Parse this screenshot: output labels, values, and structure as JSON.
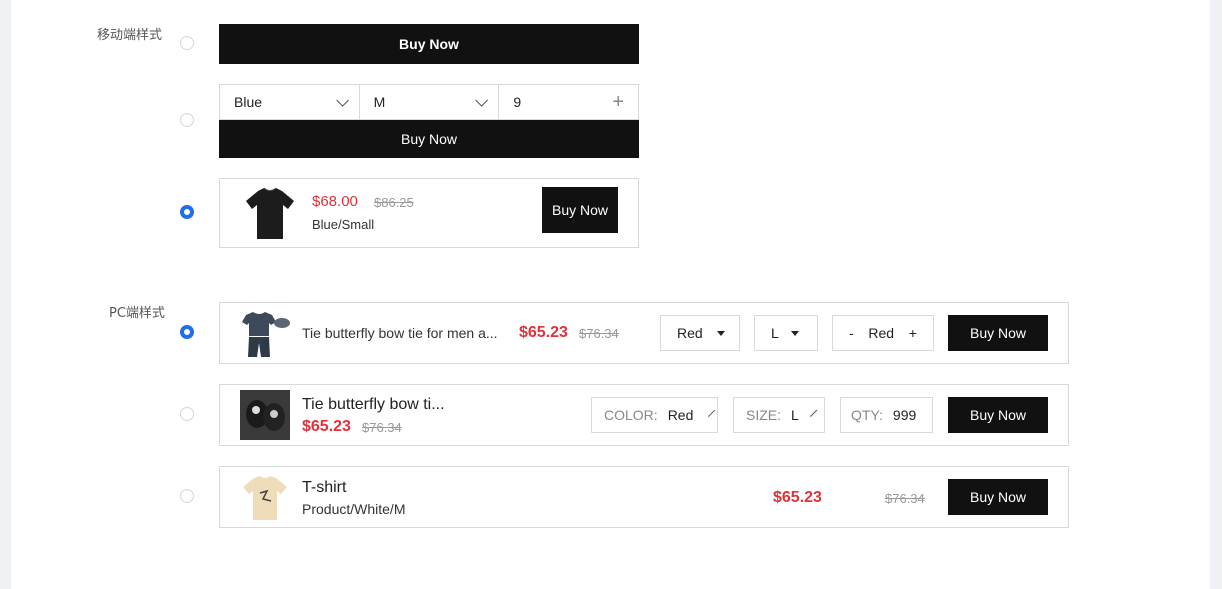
{
  "mobile": {
    "label": "移动端样式",
    "style1": {
      "button": "Buy Now"
    },
    "style2": {
      "color": "Blue",
      "size": "M",
      "qty": "9",
      "button": "Buy Now"
    },
    "style3": {
      "price": "$68.00",
      "old_price": "$86.25",
      "variant": "Blue/Small",
      "button": "Buy Now"
    },
    "selected": 3
  },
  "pc": {
    "label": "PC端样式",
    "style1": {
      "title": "Tie butterfly bow tie for men a...",
      "price": "$65.23",
      "old_price": "$76.34",
      "color": "Red",
      "size": "L",
      "qty_minus": "-",
      "qty": "Red",
      "qty_plus": "+",
      "button": "Buy Now"
    },
    "style2": {
      "title": "Tie butterfly bow ti...",
      "price": "$65.23",
      "old_price": "$76.34",
      "color_label": "COLOR:",
      "color": "Red",
      "size_label": "SIZE:",
      "size": "L",
      "qty_label": "QTY:",
      "qty": "999",
      "button": "Buy Now"
    },
    "style3": {
      "title": "T-shirt",
      "variant": "Product/White/M",
      "price": "$65.23",
      "old_price": "$76.34",
      "button": "Buy Now"
    },
    "selected": 1
  },
  "colors": {
    "accent": "#1e6fe8",
    "price": "#e0323b",
    "button": "#111111"
  }
}
